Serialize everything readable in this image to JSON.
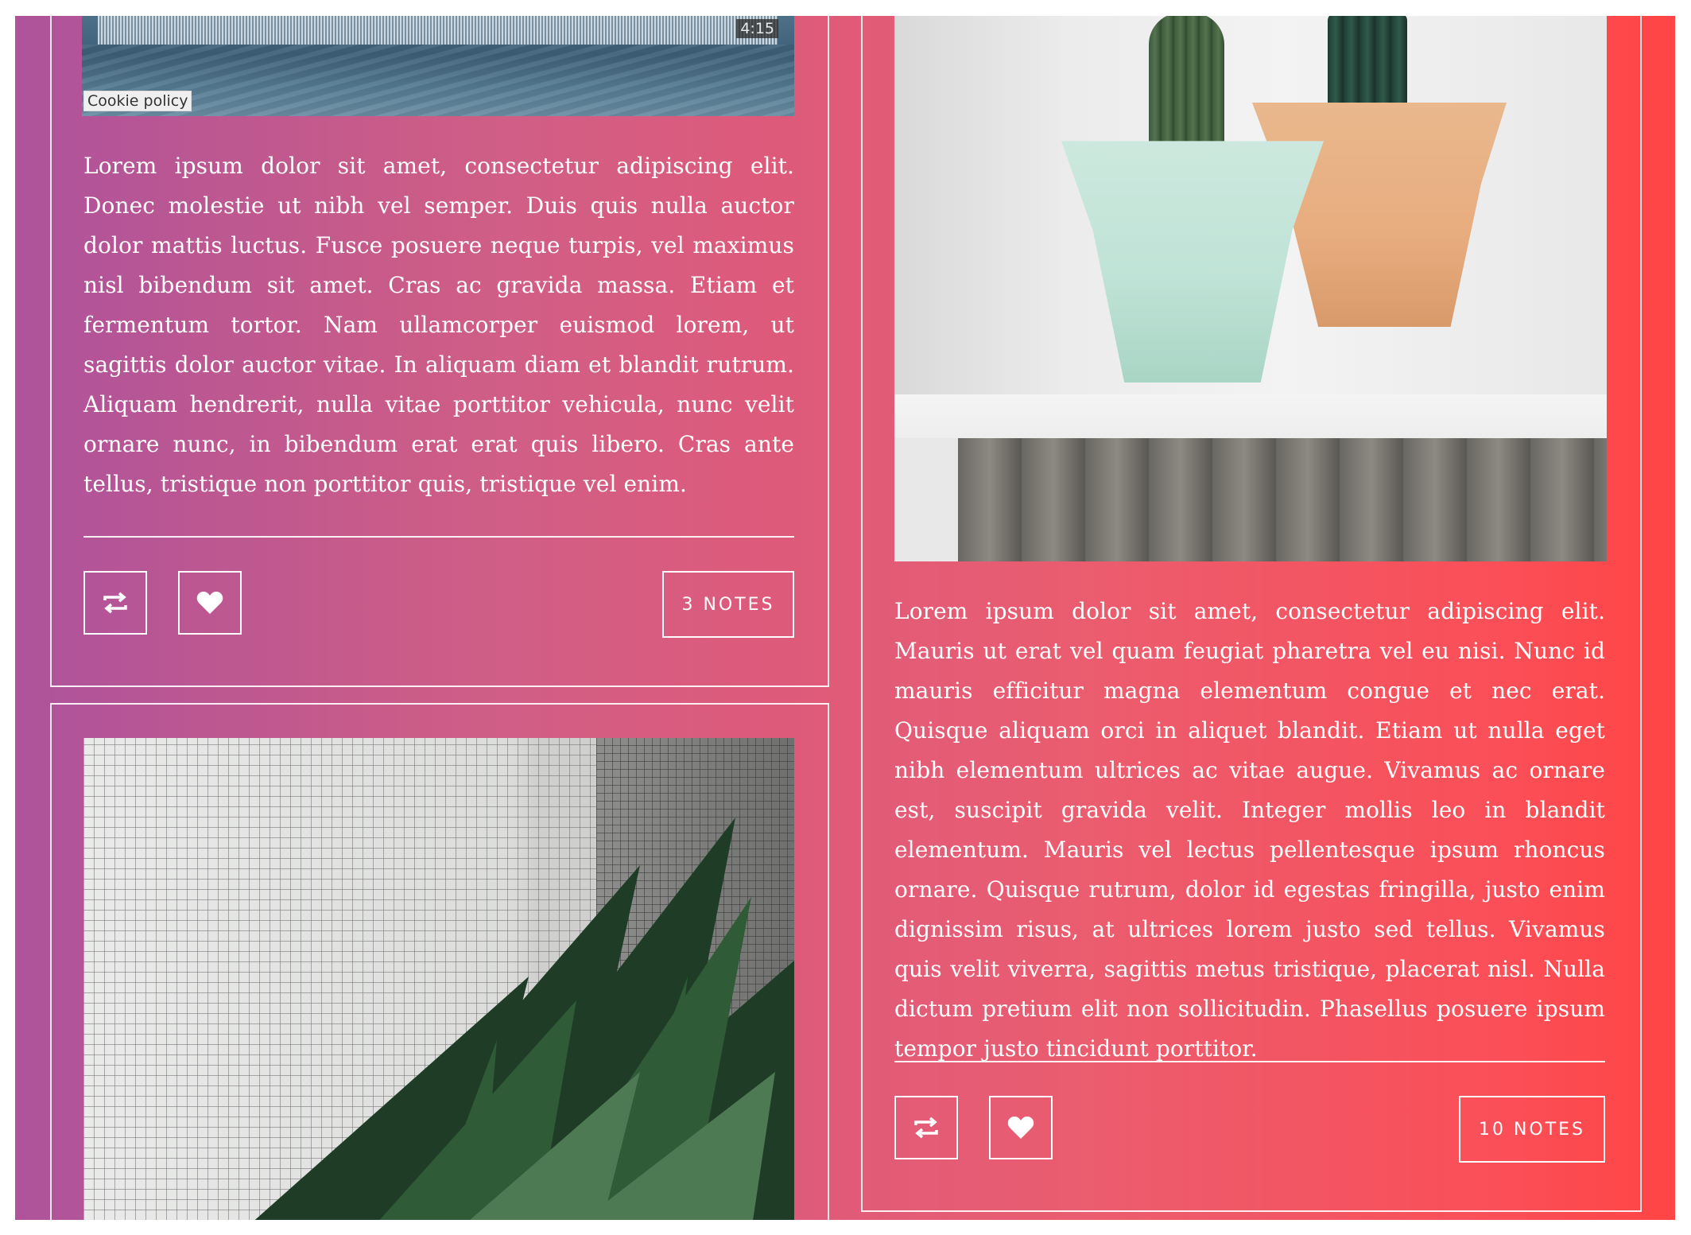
{
  "posts": [
    {
      "media": {
        "type": "audio",
        "duration": "4:15",
        "cookie_label": "Cookie policy"
      },
      "body": "Lorem ipsum dolor sit amet, consectetur adipiscing elit. Donec molestie ut nibh vel semper. Duis quis nulla auctor dolor mattis luctus. Fusce posuere neque turpis, vel maximus nisl bibendum sit amet. Cras ac gravida massa. Etiam et fermentum tortor. Nam ullamcorper euismod lorem, ut sagittis dolor auctor vitae. In aliquam diam et blandit rutrum. Aliquam hendrerit, nulla vitae porttitor vehicula, nunc velit ornare nunc, in bibendum erat erat quis libero. Cras ante tellus, tristique non porttitor quis, tristique vel enim.",
      "actions": {
        "reblog_icon": "reblog-icon",
        "like_icon": "heart-icon",
        "notes_label": "3 NOTES"
      }
    },
    {
      "media": {
        "type": "photo",
        "subject": "cactus pots on windowsill"
      },
      "body": "Lorem ipsum dolor sit amet, consectetur adipiscing elit. Mauris ut erat vel quam feugiat pharetra vel eu nisi. Nunc id mauris efficitur magna elementum congue et nec erat. Quisque aliquam orci in aliquet blandit. Etiam ut nulla eget nibh elementum ultrices ac vitae augue. Vivamus ac ornare est, suscipit gravida velit. Integer mollis leo in blandit elementum. Mauris vel lectus pellentesque ipsum rhoncus ornare. Quisque rutrum, dolor id egestas fringilla, justo enim dignissim risus, at ultrices lorem justo sed tellus. Vivamus quis velit viverra, sagittis metus tristique, placerat nisl. Nulla dictum pretium elit non sollicitudin. Phasellus posuere ipsum tempor justo tincidunt porttitor.",
      "actions": {
        "reblog_icon": "reblog-icon",
        "like_icon": "heart-icon",
        "notes_label": "10 NOTES"
      }
    },
    {
      "media": {
        "type": "photo",
        "subject": "plant against tiled wall"
      }
    }
  ],
  "theme": {
    "gradient_start": "#ae539c",
    "gradient_end": "#ff4545",
    "foreground": "#ffffff"
  }
}
